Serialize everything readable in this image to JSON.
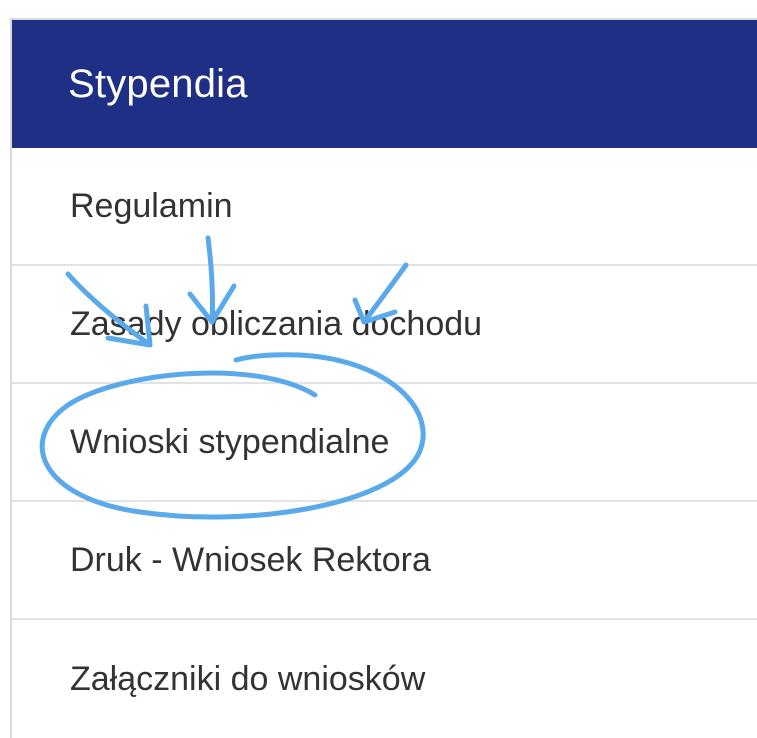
{
  "panel": {
    "title": "Stypendia",
    "header_color": "#1f2f85"
  },
  "menu": {
    "items": [
      {
        "label": "Regulamin"
      },
      {
        "label": "Zasady obliczania dochodu"
      },
      {
        "label": "Wnioski stypendialne"
      },
      {
        "label": "Druk - Wniosek Rektora"
      },
      {
        "label": "Załączniki do wniosków"
      }
    ]
  },
  "annotation": {
    "color": "#5aa9ea",
    "highlighted_item": "Wnioski stypendialne"
  }
}
